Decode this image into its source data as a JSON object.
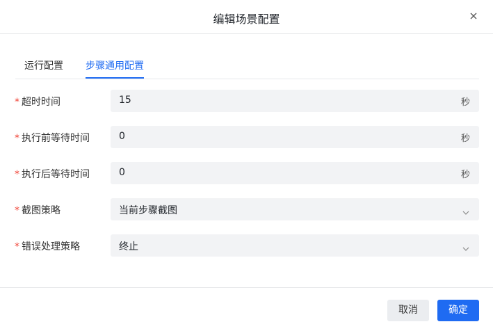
{
  "dialog": {
    "title": "编辑场景配置"
  },
  "tabs": [
    {
      "label": "运行配置",
      "active": false
    },
    {
      "label": "步骤通用配置",
      "active": true
    }
  ],
  "form": {
    "required_mark": "*",
    "fields": [
      {
        "label": "超时时间",
        "value": "15",
        "unit": "秒"
      },
      {
        "label": "执行前等待时间",
        "value": "0",
        "unit": "秒"
      },
      {
        "label": "执行后等待时间",
        "value": "0",
        "unit": "秒"
      },
      {
        "label": "截图策略",
        "value": "当前步骤截图"
      },
      {
        "label": "错误处理策略",
        "value": "终止"
      }
    ]
  },
  "footer": {
    "cancel_label": "取消",
    "confirm_label": "确定"
  },
  "colors": {
    "accent": "#1f6bf2",
    "required": "#f04134",
    "field_bg": "#f2f3f5"
  }
}
